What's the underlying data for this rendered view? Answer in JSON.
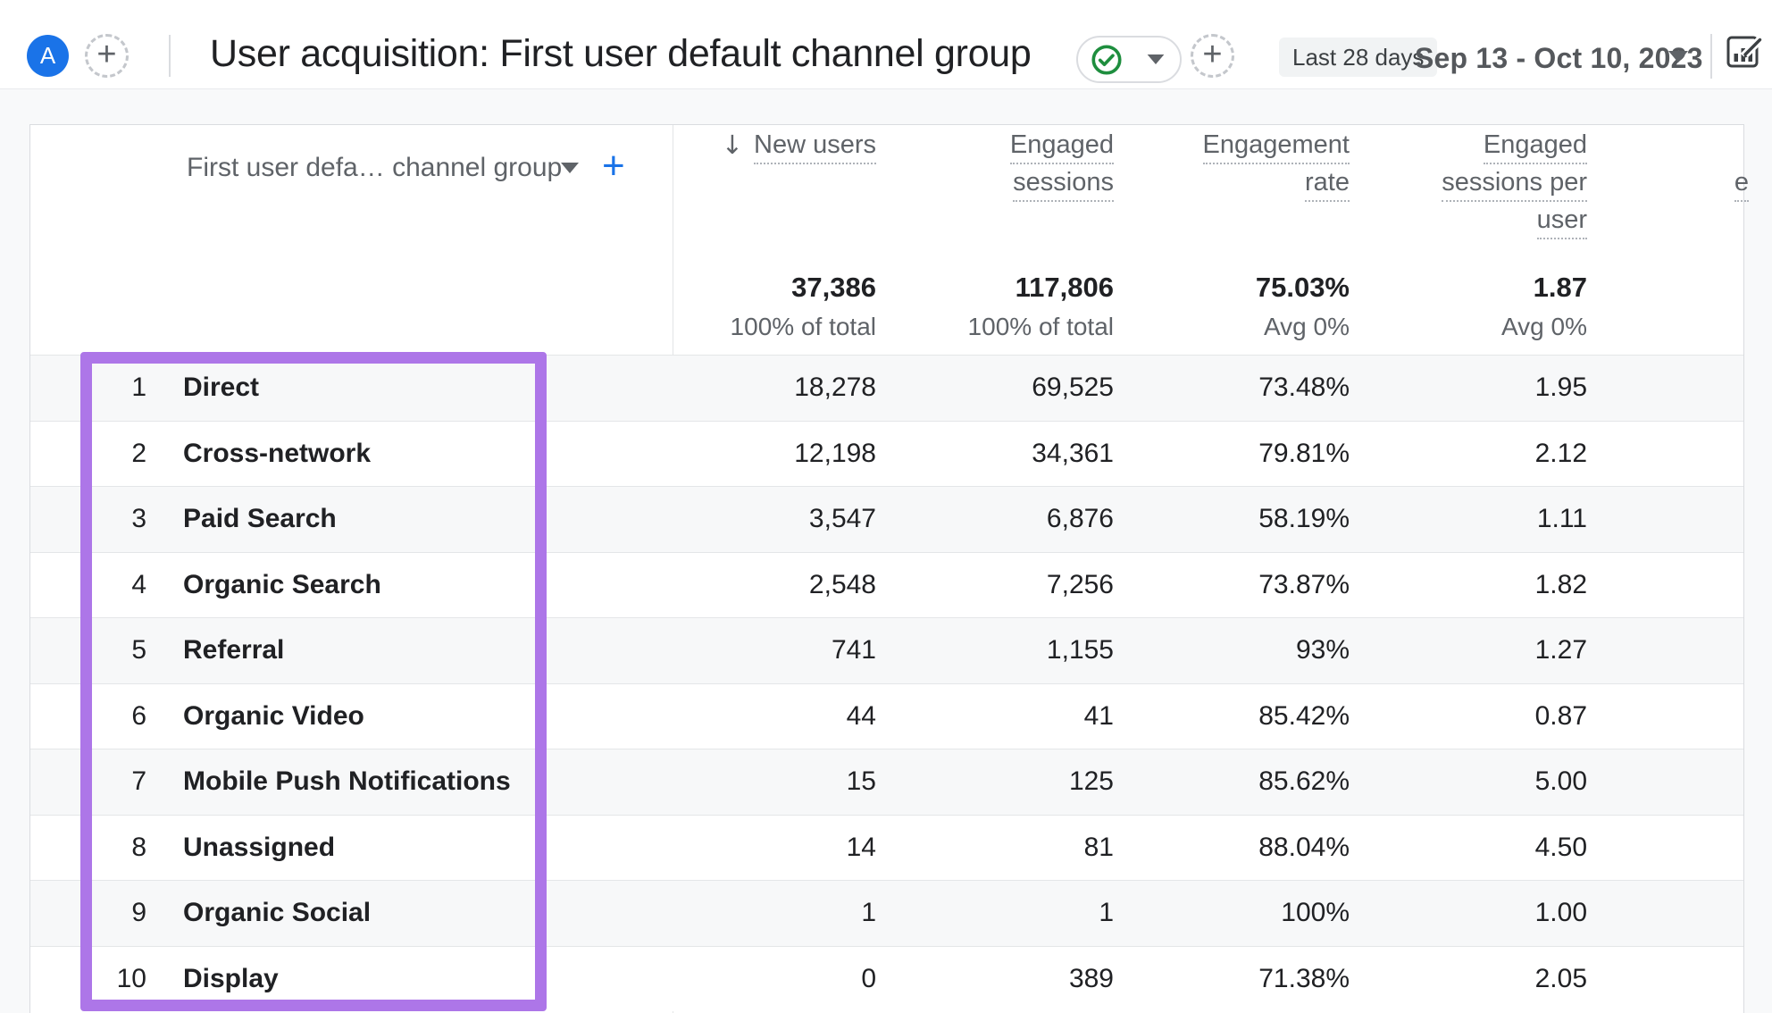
{
  "header": {
    "avatar_letter": "A",
    "title": "User acquisition: First user default channel group",
    "date_range_label": "Last 28 days",
    "date_range": "Sep 13 - Oct 10, 2023"
  },
  "icons": {
    "plus": "+",
    "sort_descending": "↓",
    "check_color": "#1e8e3e",
    "accent_blue": "#1a73e8",
    "highlight_purple": "#ad76e8"
  },
  "table": {
    "dimension_header": "First user defa… channel group",
    "metric_columns": [
      {
        "lines": [
          "New users"
        ],
        "sorted": true
      },
      {
        "lines": [
          "Engaged",
          "sessions"
        ],
        "sorted": false
      },
      {
        "lines": [
          "Engagement",
          "rate"
        ],
        "sorted": false
      },
      {
        "lines": [
          "Engaged",
          "sessions per",
          "user"
        ],
        "sorted": false
      }
    ],
    "truncated_column_label": "e",
    "totals": [
      {
        "value": "37,386",
        "sub": "100% of total"
      },
      {
        "value": "117,806",
        "sub": "100% of total"
      },
      {
        "value": "75.03%",
        "sub": "Avg 0%"
      },
      {
        "value": "1.87",
        "sub": "Avg 0%"
      }
    ],
    "rows": [
      {
        "index": "1",
        "channel": "Direct",
        "values": [
          "18,278",
          "69,525",
          "73.48%",
          "1.95"
        ]
      },
      {
        "index": "2",
        "channel": "Cross-network",
        "values": [
          "12,198",
          "34,361",
          "79.81%",
          "2.12"
        ]
      },
      {
        "index": "3",
        "channel": "Paid Search",
        "values": [
          "3,547",
          "6,876",
          "58.19%",
          "1.11"
        ]
      },
      {
        "index": "4",
        "channel": "Organic Search",
        "values": [
          "2,548",
          "7,256",
          "73.87%",
          "1.82"
        ]
      },
      {
        "index": "5",
        "channel": "Referral",
        "values": [
          "741",
          "1,155",
          "93%",
          "1.27"
        ]
      },
      {
        "index": "6",
        "channel": "Organic Video",
        "values": [
          "44",
          "41",
          "85.42%",
          "0.87"
        ]
      },
      {
        "index": "7",
        "channel": "Mobile Push Notifications",
        "values": [
          "15",
          "125",
          "85.62%",
          "5.00"
        ]
      },
      {
        "index": "8",
        "channel": "Unassigned",
        "values": [
          "14",
          "81",
          "88.04%",
          "4.50"
        ]
      },
      {
        "index": "9",
        "channel": "Organic Social",
        "values": [
          "1",
          "1",
          "100%",
          "1.00"
        ]
      },
      {
        "index": "10",
        "channel": "Display",
        "values": [
          "0",
          "389",
          "71.38%",
          "2.05"
        ]
      }
    ]
  }
}
